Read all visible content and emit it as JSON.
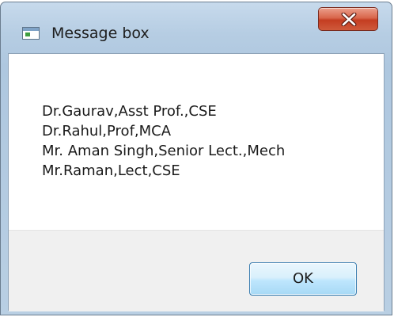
{
  "window": {
    "title": "Message box",
    "icon": "application-window-icon",
    "close_icon": "close-icon"
  },
  "message": {
    "lines": [
      "Dr.Gaurav,Asst Prof.,CSE",
      "Dr.Rahul,Prof,MCA",
      "Mr. Aman Singh,Senior Lect.,Mech",
      "Mr.Raman,Lect,CSE"
    ]
  },
  "buttons": {
    "ok_label": "OK"
  },
  "colors": {
    "close_button": "#c94a2f",
    "ok_button_border": "#3c7fb1",
    "frame": "#b6cde3"
  }
}
